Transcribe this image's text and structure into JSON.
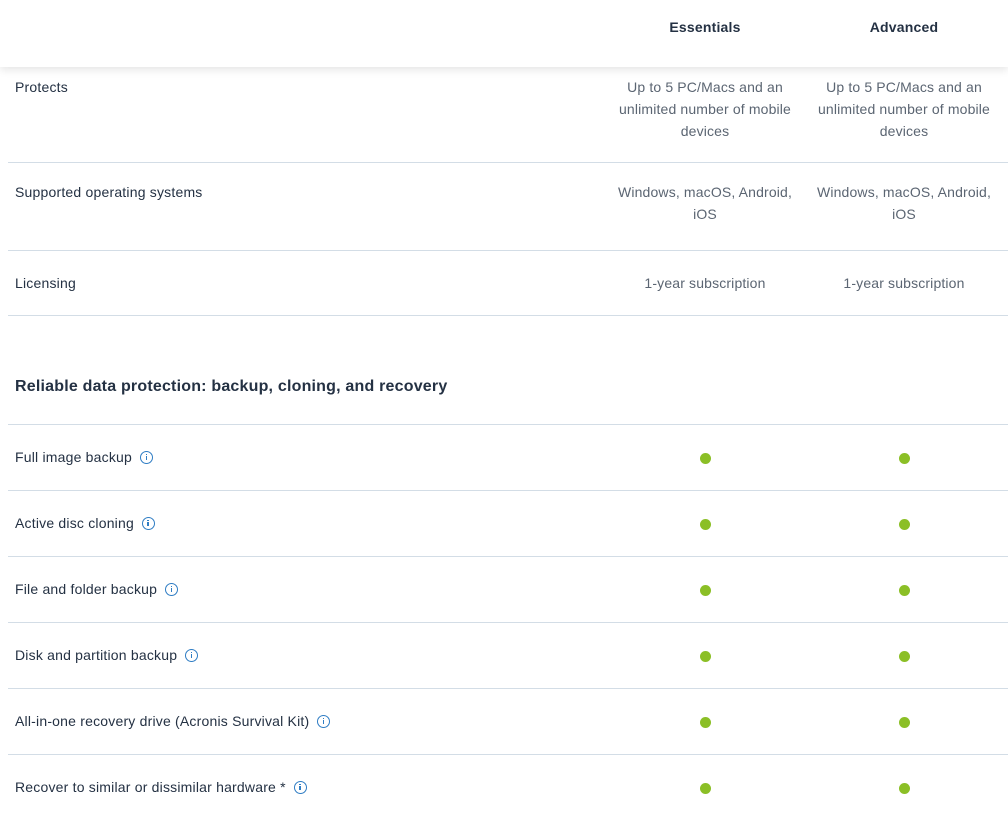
{
  "header": {
    "plans": [
      "Essentials",
      "Advanced"
    ]
  },
  "rows": {
    "protects": {
      "label": "Protects",
      "essentials": "Up to 5 PC/Macs and an unlimited number of mobile devices",
      "advanced": "Up to 5 PC/Macs and an unlimited number of mobile devices"
    },
    "os": {
      "label": "Supported operating systems",
      "essentials": "Windows, macOS, Android, iOS",
      "advanced": "Windows, macOS, Android, iOS"
    },
    "licensing": {
      "label": "Licensing",
      "essentials": "1-year subscription",
      "advanced": "1-year subscription"
    }
  },
  "section": {
    "title": "Reliable data protection: backup, cloning, and recovery"
  },
  "features": [
    {
      "label": "Full image backup",
      "essentials": true,
      "advanced": true,
      "icon": "info-icon"
    },
    {
      "label": "Active disc cloning",
      "essentials": true,
      "advanced": true,
      "icon": "info-icon"
    },
    {
      "label": "File and folder backup",
      "essentials": true,
      "advanced": true,
      "icon": "info-icon"
    },
    {
      "label": "Disk and partition backup",
      "essentials": true,
      "advanced": true,
      "icon": "info-icon"
    },
    {
      "label": "All-in-one recovery drive (Acronis Survival Kit)",
      "essentials": true,
      "advanced": true,
      "icon": "info-icon"
    },
    {
      "label": "Recover to similar or dissimilar hardware *",
      "essentials": true,
      "advanced": true,
      "icon": "info-icon"
    }
  ],
  "colors": {
    "included_dot": "#8bbf26",
    "info_icon": "#2f7dc4",
    "divider": "#d3dde6",
    "text": "#243143"
  }
}
